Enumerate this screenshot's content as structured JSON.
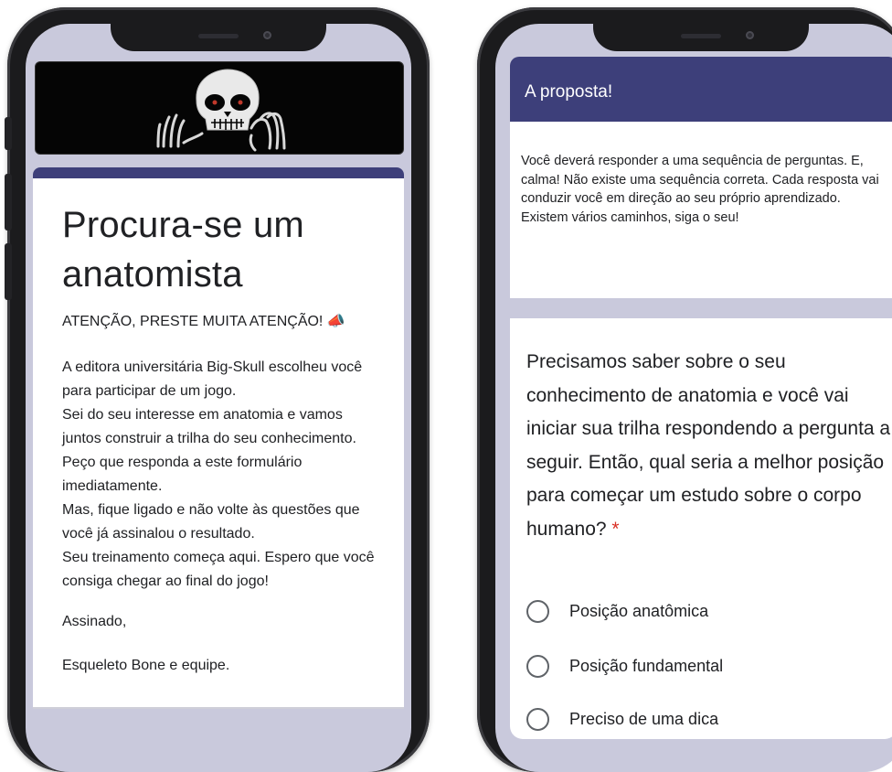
{
  "left_phone": {
    "banner_icon": "skull-hands-icon",
    "form": {
      "title": "Procura-se um anatomista",
      "intro": "ATENÇÃO, PRESTE MUITA ATENÇÃO! 📣",
      "body": "A editora universitária Big-Skull escolheu você para participar de um jogo.\nSei do seu interesse em anatomia e vamos juntos construir a trilha do seu conhecimento.\nPeço que responda a este formulário imediatamente.\nMas, fique ligado e não volte às questões que você já assinalou o resultado.\nSeu treinamento começa aqui. Espero que você consiga chegar ao final do jogo!",
      "signature_label": "Assinado,",
      "signature_name": "Esqueleto Bone e equipe."
    }
  },
  "right_phone": {
    "section_title": "A proposta!",
    "section_description": "Você deverá responder a uma sequência de perguntas. E, calma! Não existe uma sequência correta. Cada resposta vai conduzir você em direção ao seu próprio aprendizado. Existem vários caminhos, siga o seu!",
    "question": {
      "text": "Precisamos saber sobre o seu conhecimento de anatomia e você vai iniciar sua trilha respondendo a pergunta a seguir. Então, qual seria a melhor posição para começar um estudo sobre o corpo humano?",
      "required_mark": "*",
      "options": [
        "Posição anatômica",
        "Posição fundamental",
        "Preciso de uma dica"
      ]
    }
  },
  "colors": {
    "accent": "#3d3f7a",
    "background": "#c9c9dc",
    "phone_frame": "#1b1b1d",
    "required": "#d93025"
  }
}
